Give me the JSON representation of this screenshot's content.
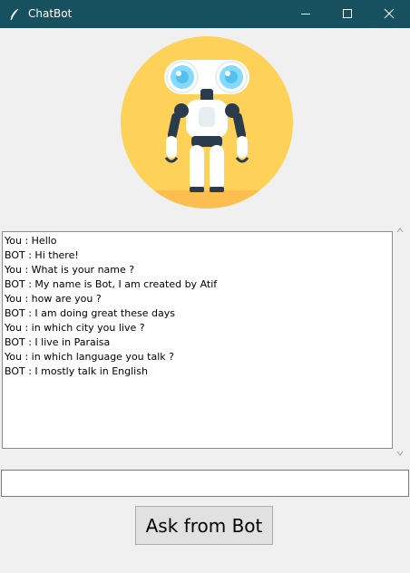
{
  "window": {
    "title": "ChatBot",
    "titlebar_color": "#17505e",
    "icon": "feather-icon",
    "controls": [
      "minimize-icon",
      "maximize-icon",
      "close-icon"
    ]
  },
  "robot_image": {
    "icon": "robot-icon",
    "circle_color": "#fed158"
  },
  "chat": {
    "lines": [
      "You : Hello",
      "BOT : Hi there!",
      "You : What is your name ?",
      "BOT : My name is Bot, I am created by Atif",
      "You : how are you ?",
      "BOT : I am doing great these days",
      "You : in which city you live ?",
      "BOT : I live in Paraisa",
      "You : in which language you talk ?",
      "BOT : I mostly talk in English"
    ]
  },
  "input": {
    "value": ""
  },
  "ask_button": {
    "label": "Ask from Bot"
  }
}
